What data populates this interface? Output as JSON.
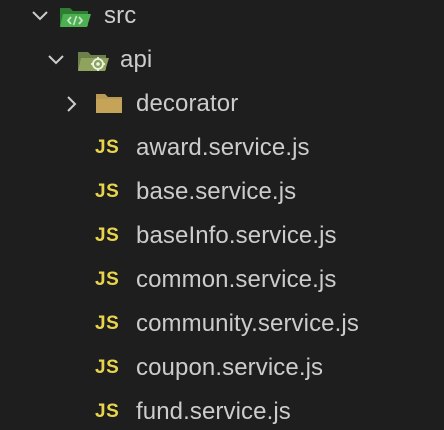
{
  "tree": {
    "src": {
      "label": "src",
      "expanded": true,
      "icon": "folder-src-open-icon"
    },
    "api": {
      "label": "api",
      "expanded": true,
      "icon": "folder-api-open-icon"
    },
    "decorator": {
      "label": "decorator",
      "expanded": false,
      "icon": "folder-closed-icon"
    },
    "files": [
      {
        "label": "award.service.js",
        "icon_text": "JS"
      },
      {
        "label": "base.service.js",
        "icon_text": "JS"
      },
      {
        "label": "baseInfo.service.js",
        "icon_text": "JS"
      },
      {
        "label": "common.service.js",
        "icon_text": "JS"
      },
      {
        "label": "community.service.js",
        "icon_text": "JS"
      },
      {
        "label": "coupon.service.js",
        "icon_text": "JS"
      },
      {
        "label": "fund.service.js",
        "icon_text": "JS"
      }
    ]
  },
  "colors": {
    "background": "#1e1e1e",
    "text": "#cccccc",
    "js_icon": "#e8d44d",
    "folder_green": "#4caf50",
    "folder_tan": "#c5a45a"
  }
}
